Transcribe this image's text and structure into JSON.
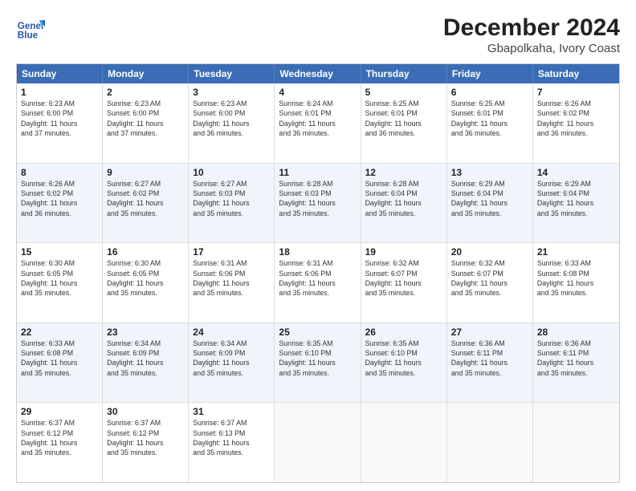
{
  "logo": {
    "text1": "General",
    "text2": "Blue"
  },
  "title": "December 2024",
  "subtitle": "Gbapolkaha, Ivory Coast",
  "header_days": [
    "Sunday",
    "Monday",
    "Tuesday",
    "Wednesday",
    "Thursday",
    "Friday",
    "Saturday"
  ],
  "rows": [
    {
      "alt": false,
      "cells": [
        {
          "day": "1",
          "info": "Sunrise: 6:23 AM\nSunset: 6:00 PM\nDaylight: 11 hours\nand 37 minutes."
        },
        {
          "day": "2",
          "info": "Sunrise: 6:23 AM\nSunset: 6:00 PM\nDaylight: 11 hours\nand 37 minutes."
        },
        {
          "day": "3",
          "info": "Sunrise: 6:23 AM\nSunset: 6:00 PM\nDaylight: 11 hours\nand 36 minutes."
        },
        {
          "day": "4",
          "info": "Sunrise: 6:24 AM\nSunset: 6:01 PM\nDaylight: 11 hours\nand 36 minutes."
        },
        {
          "day": "5",
          "info": "Sunrise: 6:25 AM\nSunset: 6:01 PM\nDaylight: 11 hours\nand 36 minutes."
        },
        {
          "day": "6",
          "info": "Sunrise: 6:25 AM\nSunset: 6:01 PM\nDaylight: 11 hours\nand 36 minutes."
        },
        {
          "day": "7",
          "info": "Sunrise: 6:26 AM\nSunset: 6:02 PM\nDaylight: 11 hours\nand 36 minutes."
        }
      ]
    },
    {
      "alt": true,
      "cells": [
        {
          "day": "8",
          "info": "Sunrise: 6:26 AM\nSunset: 6:02 PM\nDaylight: 11 hours\nand 36 minutes."
        },
        {
          "day": "9",
          "info": "Sunrise: 6:27 AM\nSunset: 6:02 PM\nDaylight: 11 hours\nand 35 minutes."
        },
        {
          "day": "10",
          "info": "Sunrise: 6:27 AM\nSunset: 6:03 PM\nDaylight: 11 hours\nand 35 minutes."
        },
        {
          "day": "11",
          "info": "Sunrise: 6:28 AM\nSunset: 6:03 PM\nDaylight: 11 hours\nand 35 minutes."
        },
        {
          "day": "12",
          "info": "Sunrise: 6:28 AM\nSunset: 6:04 PM\nDaylight: 11 hours\nand 35 minutes."
        },
        {
          "day": "13",
          "info": "Sunrise: 6:29 AM\nSunset: 6:04 PM\nDaylight: 11 hours\nand 35 minutes."
        },
        {
          "day": "14",
          "info": "Sunrise: 6:29 AM\nSunset: 6:04 PM\nDaylight: 11 hours\nand 35 minutes."
        }
      ]
    },
    {
      "alt": false,
      "cells": [
        {
          "day": "15",
          "info": "Sunrise: 6:30 AM\nSunset: 6:05 PM\nDaylight: 11 hours\nand 35 minutes."
        },
        {
          "day": "16",
          "info": "Sunrise: 6:30 AM\nSunset: 6:05 PM\nDaylight: 11 hours\nand 35 minutes."
        },
        {
          "day": "17",
          "info": "Sunrise: 6:31 AM\nSunset: 6:06 PM\nDaylight: 11 hours\nand 35 minutes."
        },
        {
          "day": "18",
          "info": "Sunrise: 6:31 AM\nSunset: 6:06 PM\nDaylight: 11 hours\nand 35 minutes."
        },
        {
          "day": "19",
          "info": "Sunrise: 6:32 AM\nSunset: 6:07 PM\nDaylight: 11 hours\nand 35 minutes."
        },
        {
          "day": "20",
          "info": "Sunrise: 6:32 AM\nSunset: 6:07 PM\nDaylight: 11 hours\nand 35 minutes."
        },
        {
          "day": "21",
          "info": "Sunrise: 6:33 AM\nSunset: 6:08 PM\nDaylight: 11 hours\nand 35 minutes."
        }
      ]
    },
    {
      "alt": true,
      "cells": [
        {
          "day": "22",
          "info": "Sunrise: 6:33 AM\nSunset: 6:08 PM\nDaylight: 11 hours\nand 35 minutes."
        },
        {
          "day": "23",
          "info": "Sunrise: 6:34 AM\nSunset: 6:09 PM\nDaylight: 11 hours\nand 35 minutes."
        },
        {
          "day": "24",
          "info": "Sunrise: 6:34 AM\nSunset: 6:09 PM\nDaylight: 11 hours\nand 35 minutes."
        },
        {
          "day": "25",
          "info": "Sunrise: 6:35 AM\nSunset: 6:10 PM\nDaylight: 11 hours\nand 35 minutes."
        },
        {
          "day": "26",
          "info": "Sunrise: 6:35 AM\nSunset: 6:10 PM\nDaylight: 11 hours\nand 35 minutes."
        },
        {
          "day": "27",
          "info": "Sunrise: 6:36 AM\nSunset: 6:11 PM\nDaylight: 11 hours\nand 35 minutes."
        },
        {
          "day": "28",
          "info": "Sunrise: 6:36 AM\nSunset: 6:11 PM\nDaylight: 11 hours\nand 35 minutes."
        }
      ]
    },
    {
      "alt": false,
      "cells": [
        {
          "day": "29",
          "info": "Sunrise: 6:37 AM\nSunset: 6:12 PM\nDaylight: 11 hours\nand 35 minutes."
        },
        {
          "day": "30",
          "info": "Sunrise: 6:37 AM\nSunset: 6:12 PM\nDaylight: 11 hours\nand 35 minutes."
        },
        {
          "day": "31",
          "info": "Sunrise: 6:37 AM\nSunset: 6:13 PM\nDaylight: 11 hours\nand 35 minutes."
        },
        {
          "day": "",
          "info": ""
        },
        {
          "day": "",
          "info": ""
        },
        {
          "day": "",
          "info": ""
        },
        {
          "day": "",
          "info": ""
        }
      ]
    }
  ]
}
